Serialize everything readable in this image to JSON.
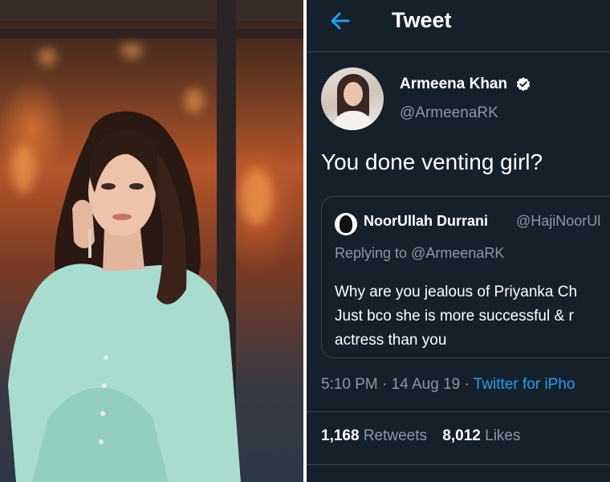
{
  "header": {
    "title": "Tweet",
    "back_icon": "back-arrow-icon"
  },
  "tweet": {
    "author_name": "Armeena Khan",
    "author_handle": "@ArmeenaRK",
    "text": "You done venting girl?",
    "timestamp": "5:10 PM · 14 Aug 19 ·",
    "source": "Twitter for iPho",
    "retweets_count": "1,168",
    "retweets_label": "Retweets",
    "likes_count": "8,012",
    "likes_label": "Likes"
  },
  "quote": {
    "author_name": "NoorUllah Durrani",
    "author_handle": "@HajiNoorUl",
    "replying_prefix": "Replying to",
    "replying_handle": "@ArmeenaRK",
    "lines": [
      "Why are you jealous of Priyanka Ch",
      "Just bco she is more successful & r",
      "actress than you"
    ]
  },
  "colors": {
    "background": "#15202b",
    "accent": "#1da1f2",
    "muted": "#8899a6",
    "border": "#38444d"
  }
}
